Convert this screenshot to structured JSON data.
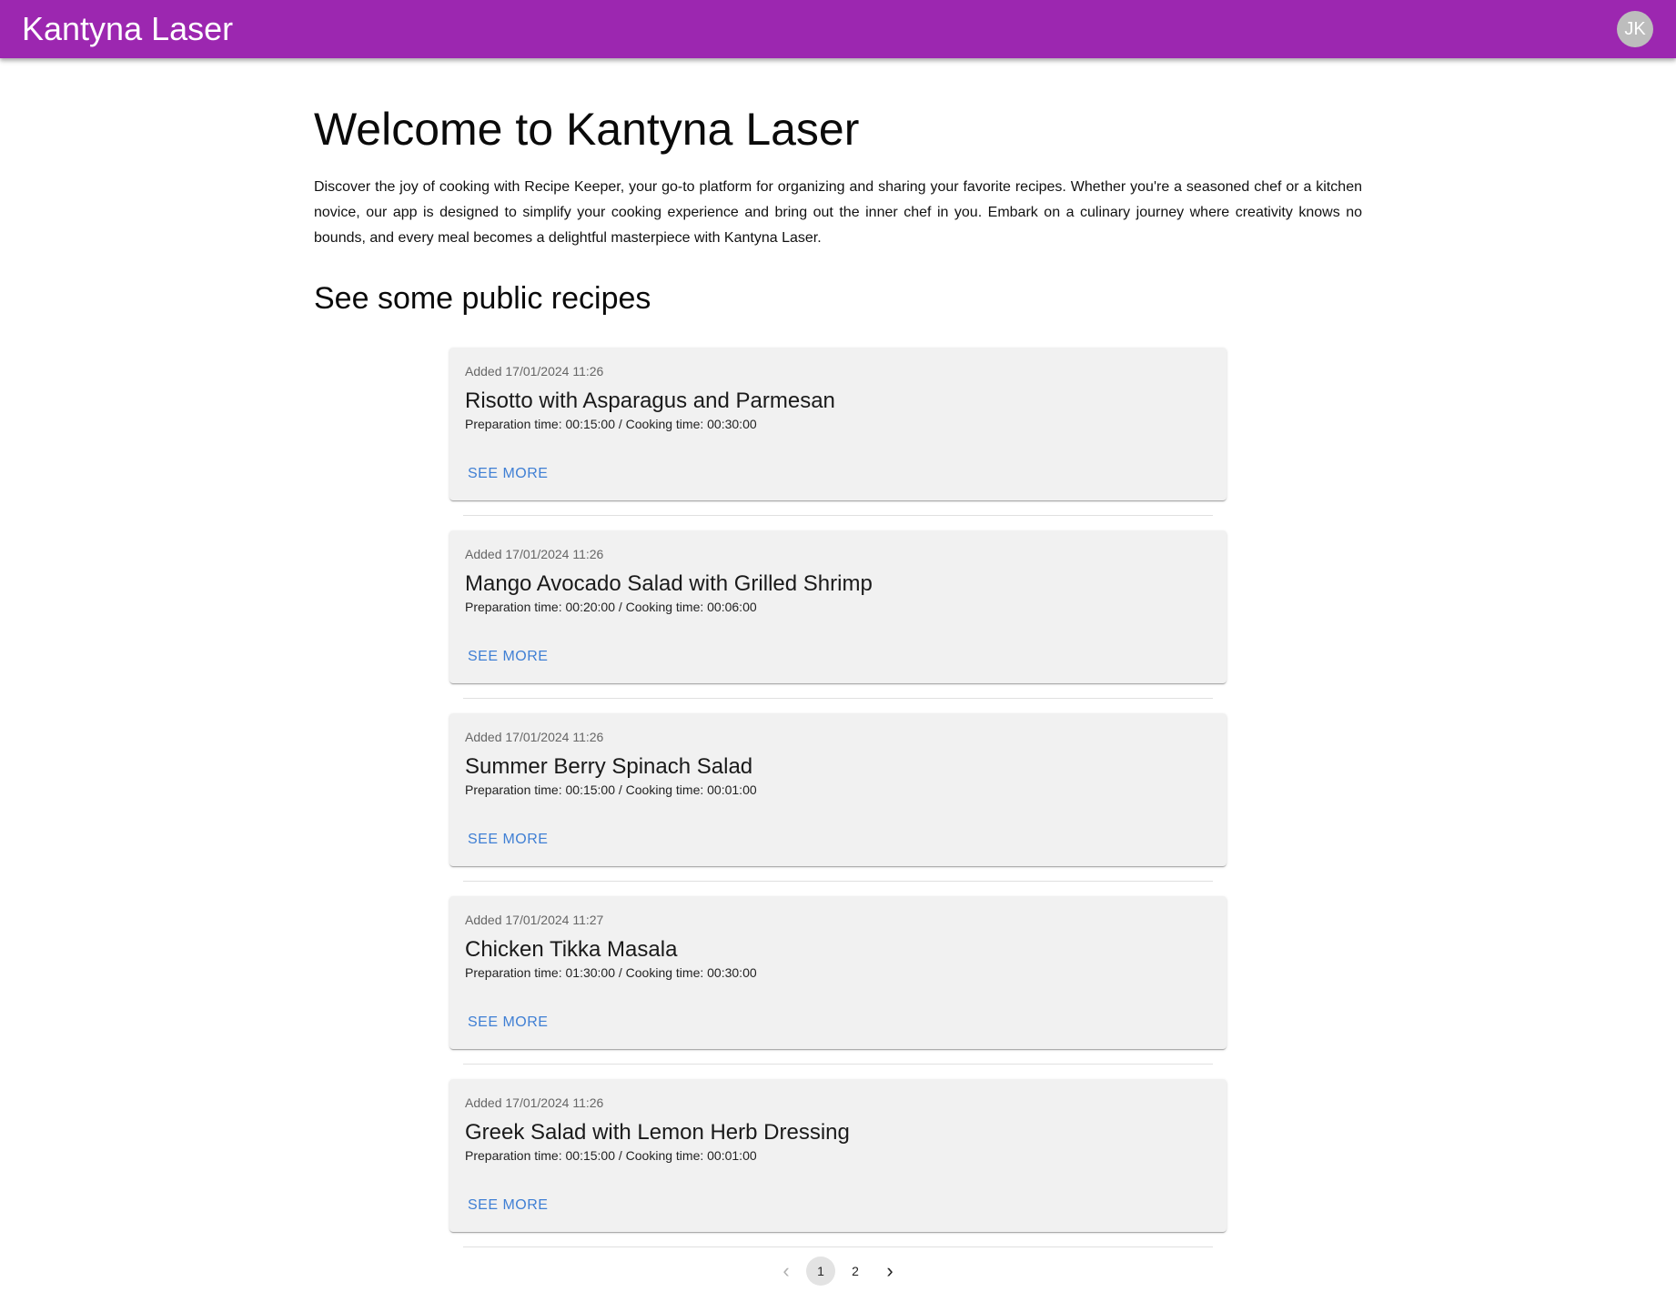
{
  "header": {
    "brand": "Kantyna Laser",
    "avatar_initials": "JK",
    "bar_color": "#9c27b0"
  },
  "main": {
    "welcome_title": "Welcome to Kantyna Laser",
    "intro": "Discover the joy of cooking with Recipe Keeper, your go-to platform for organizing and sharing your favorite recipes. Whether you're a seasoned chef or a kitchen novice, our app is designed to simplify your cooking experience and bring out the inner chef in you. Embark on a culinary journey where creativity knows no bounds, and every meal becomes a delightful masterpiece with Kantyna Laser.",
    "section_title": "See some public recipes"
  },
  "recipes": [
    {
      "added": "Added 17/01/2024 11:26",
      "title": "Risotto with Asparagus and Parmesan",
      "times": "Preparation time: 00:15:00 / Cooking time: 00:30:00",
      "action": "SEE MORE"
    },
    {
      "added": "Added 17/01/2024 11:26",
      "title": "Mango Avocado Salad with Grilled Shrimp",
      "times": "Preparation time: 00:20:00 / Cooking time: 00:06:00",
      "action": "SEE MORE"
    },
    {
      "added": "Added 17/01/2024 11:26",
      "title": "Summer Berry Spinach Salad",
      "times": "Preparation time: 00:15:00 / Cooking time: 00:01:00",
      "action": "SEE MORE"
    },
    {
      "added": "Added 17/01/2024 11:27",
      "title": "Chicken Tikka Masala",
      "times": "Preparation time: 01:30:00 / Cooking time: 00:30:00",
      "action": "SEE MORE"
    },
    {
      "added": "Added 17/01/2024 11:26",
      "title": "Greek Salad with Lemon Herb Dressing",
      "times": "Preparation time: 00:15:00 / Cooking time: 00:01:00",
      "action": "SEE MORE"
    }
  ],
  "pagination": {
    "prev_icon": "chevron-left-icon",
    "next_icon": "chevron-right-icon",
    "pages": [
      "1",
      "2"
    ],
    "current": "1"
  }
}
